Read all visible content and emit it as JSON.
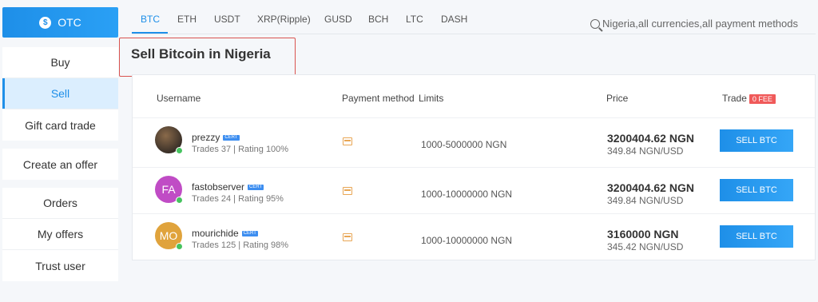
{
  "sidebar": {
    "otc_label": "OTC",
    "otc_icon": "$",
    "group1": [
      "Buy",
      "Sell",
      "Gift card trade"
    ],
    "group2": [
      "Create an offer"
    ],
    "group3": [
      "Orders",
      "My offers",
      "Trust user"
    ]
  },
  "tabs": [
    "BTC",
    "ETH",
    "USDT",
    "XRP(Ripple)",
    "GUSD",
    "BCH",
    "LTC",
    "DASH"
  ],
  "search": {
    "placeholder": "Nigeria,all currencies,all payment methods"
  },
  "page_title": "Sell Bitcoin in Nigeria",
  "table": {
    "headers": {
      "username": "Username",
      "payment": "Payment method",
      "limits": "Limits",
      "price": "Price",
      "trade": "Trade",
      "fee": "0 FEE"
    },
    "rows": [
      {
        "avatar": "",
        "avatar_color": "#5a4a3a",
        "username": "prezzy",
        "cert": "CERT",
        "stats": "Trades 37 | Rating 100%",
        "limits": "1000-5000000 NGN",
        "price": "3200404.62 NGN",
        "unit_price": "349.84 NGN/USD",
        "button": "SELL BTC"
      },
      {
        "avatar": "FA",
        "avatar_color": "#c04cc5",
        "username": "fastobserver",
        "cert": "CERT",
        "stats": "Trades 24 | Rating 95%",
        "limits": "1000-10000000 NGN",
        "price": "3200404.62 NGN",
        "unit_price": "349.84 NGN/USD",
        "button": "SELL BTC"
      },
      {
        "avatar": "MO",
        "avatar_color": "#e0a33c",
        "username": "mourichide",
        "cert": "CERT",
        "stats": "Trades 125 | Rating 98%",
        "limits": "1000-10000000 NGN",
        "price": "3160000 NGN",
        "unit_price": "345.42 NGN/USD",
        "button": "SELL BTC"
      }
    ]
  }
}
